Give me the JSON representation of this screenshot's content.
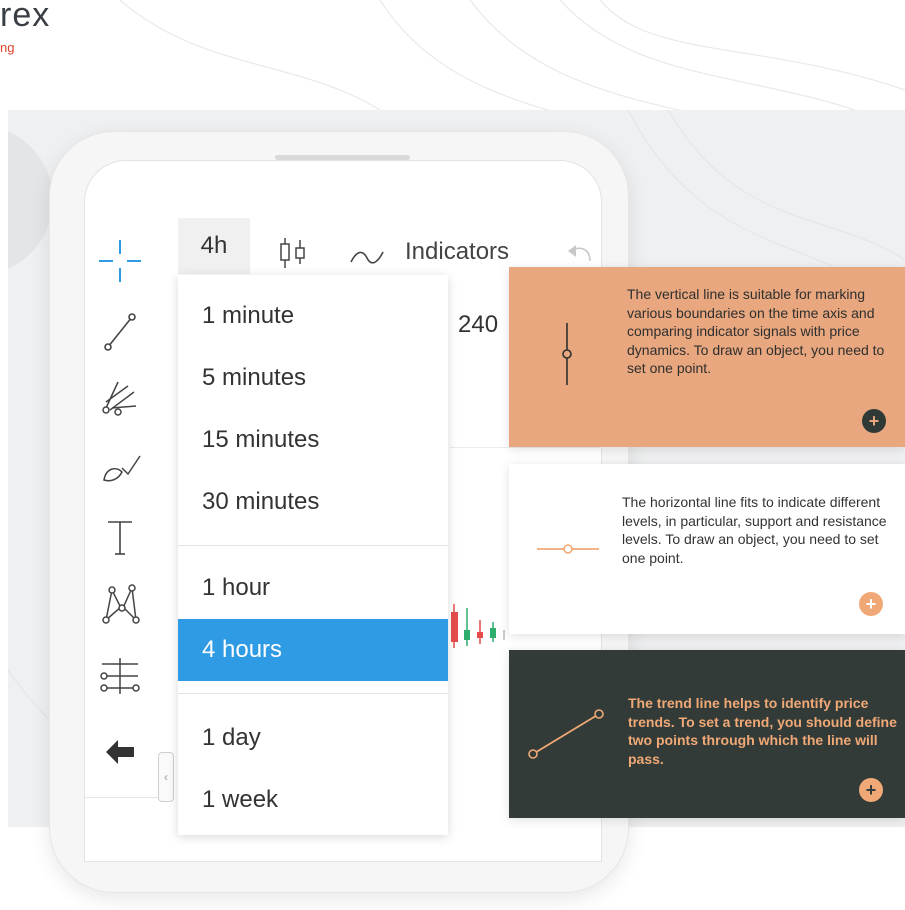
{
  "brand": {
    "name": "rex",
    "subtitle": "ng"
  },
  "toolbar": {
    "timeframe_label": "4h",
    "indicators_label": "Indicators",
    "tools": [
      "crosshair-icon",
      "line-tool-icon",
      "pitchfork-icon",
      "brush-icon",
      "text-tool-icon",
      "pattern-icon",
      "fibonacci-icon",
      "back-arrow-icon"
    ],
    "collapse_label": "‹"
  },
  "chart": {
    "price_label": "240"
  },
  "timeframe_menu": {
    "selected": "4 hours",
    "items": [
      {
        "label": "1 minute"
      },
      {
        "label": "5 minutes"
      },
      {
        "label": "15 minutes"
      },
      {
        "label": "30 minutes"
      },
      {
        "label": "1 hour"
      },
      {
        "label": "4 hours"
      },
      {
        "label": "1 day"
      },
      {
        "label": "1 week"
      }
    ]
  },
  "cards": [
    {
      "text": "The vertical line is suitable for marking various boundaries on the time axis and comparing indicator signals with price dynamics. To draw an object, you need to set one point.",
      "icon": "vertical-line-icon",
      "bg": "#e8a77e"
    },
    {
      "text": "The horizontal line fits to indicate different levels, in particular, support and resistance levels. To draw an object, you need to set one point.",
      "icon": "horizontal-line-icon",
      "bg": "#ffffff"
    },
    {
      "text": "The trend line helps to identify price trends. To set a trend, you should define two points through which the line will pass.",
      "icon": "trend-line-icon",
      "bg": "#333b38"
    }
  ],
  "plus_label": "+",
  "colors": {
    "accent": "#2f9be4",
    "peach": "#e8a77e",
    "dark": "#333b38",
    "brand_red": "#e0452f"
  }
}
